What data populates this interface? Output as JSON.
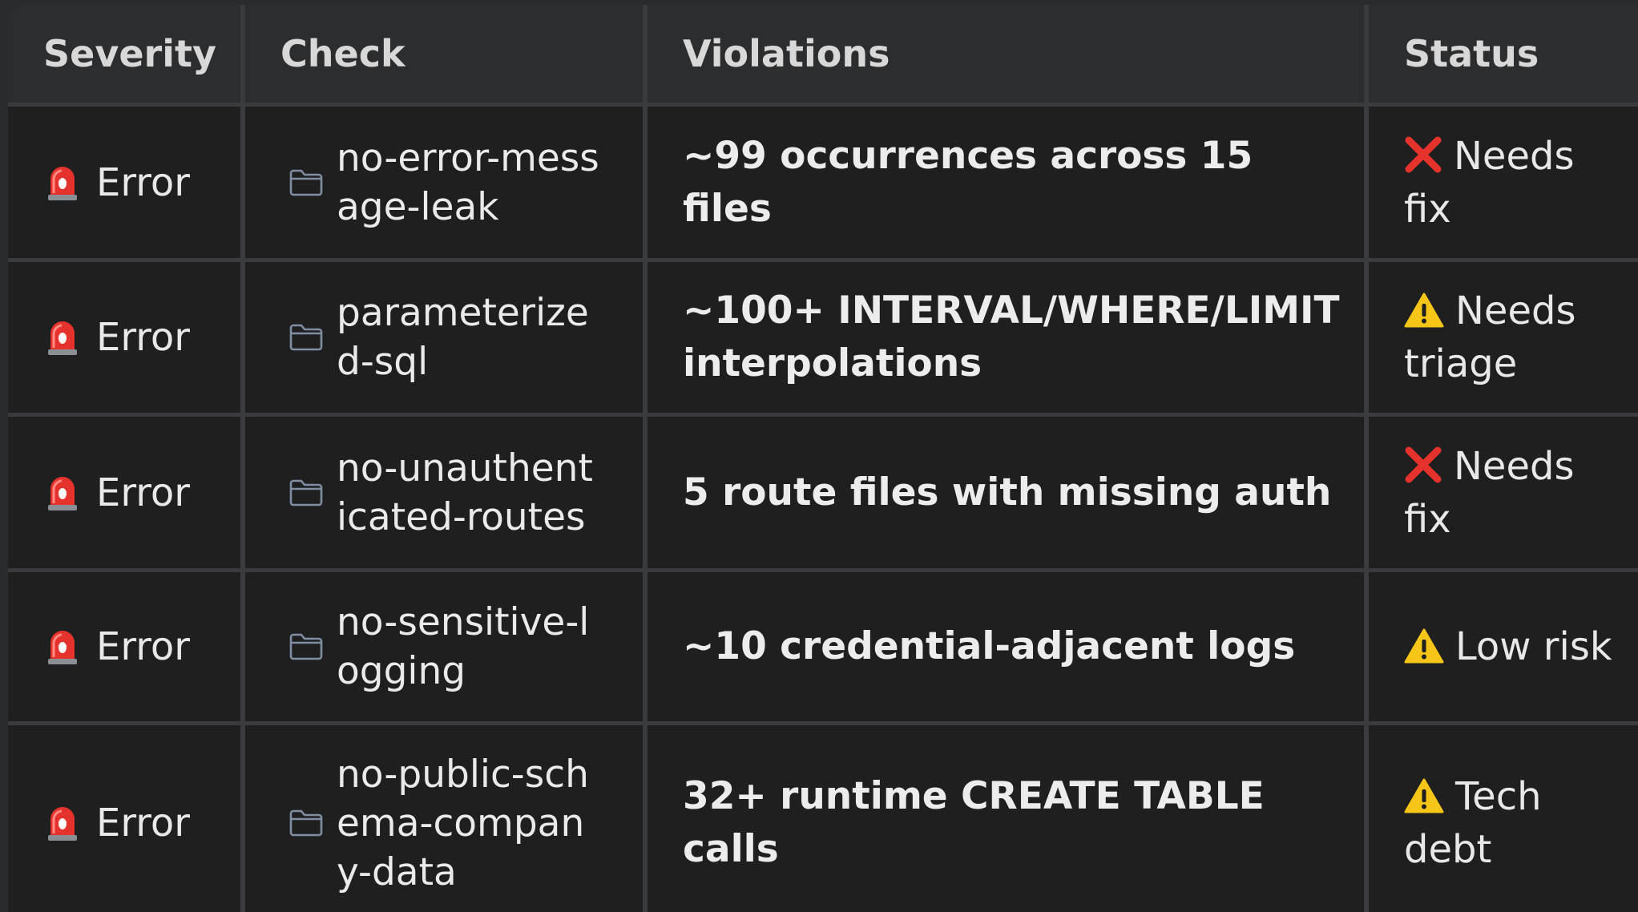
{
  "table": {
    "headers": {
      "severity": "Severity",
      "check": "Check",
      "violations": "Violations",
      "status": "Status"
    },
    "rows": [
      {
        "severity": "Error",
        "severity_icon": "siren-icon",
        "check": "no-error-message-leak",
        "check_icon": "folder-icon",
        "violations": "~99 occurrences across 15 files",
        "status_icon": "cross-mark-icon",
        "status": "Needs fix"
      },
      {
        "severity": "Error",
        "severity_icon": "siren-icon",
        "check": "parameterized-sql",
        "check_icon": "folder-icon",
        "violations": "~100+ INTERVAL/WHERE/LIMIT interpolations",
        "status_icon": "warning-icon",
        "status": "Needs triage"
      },
      {
        "severity": "Error",
        "severity_icon": "siren-icon",
        "check": "no-unauthenticated-routes",
        "check_icon": "folder-icon",
        "violations": "5 route files with missing auth",
        "status_icon": "cross-mark-icon",
        "status": "Needs fix"
      },
      {
        "severity": "Error",
        "severity_icon": "siren-icon",
        "check": "no-sensitive-logging",
        "check_icon": "folder-icon",
        "violations": "~10 credential-adjacent logs",
        "status_icon": "warning-icon",
        "status": "Low risk"
      },
      {
        "severity": "Error",
        "severity_icon": "siren-icon",
        "check": "no-public-schema-company-data",
        "check_icon": "folder-icon",
        "violations": "32+ runtime CREATE TABLE calls",
        "status_icon": "warning-icon",
        "status": "Tech debt"
      }
    ]
  },
  "colors": {
    "background": "#1f1f20",
    "header_background": "#2c2d2f",
    "grid_lines": "#3a3b3e",
    "error_red": "#e5322d",
    "warning_yellow": "#f5c518"
  }
}
